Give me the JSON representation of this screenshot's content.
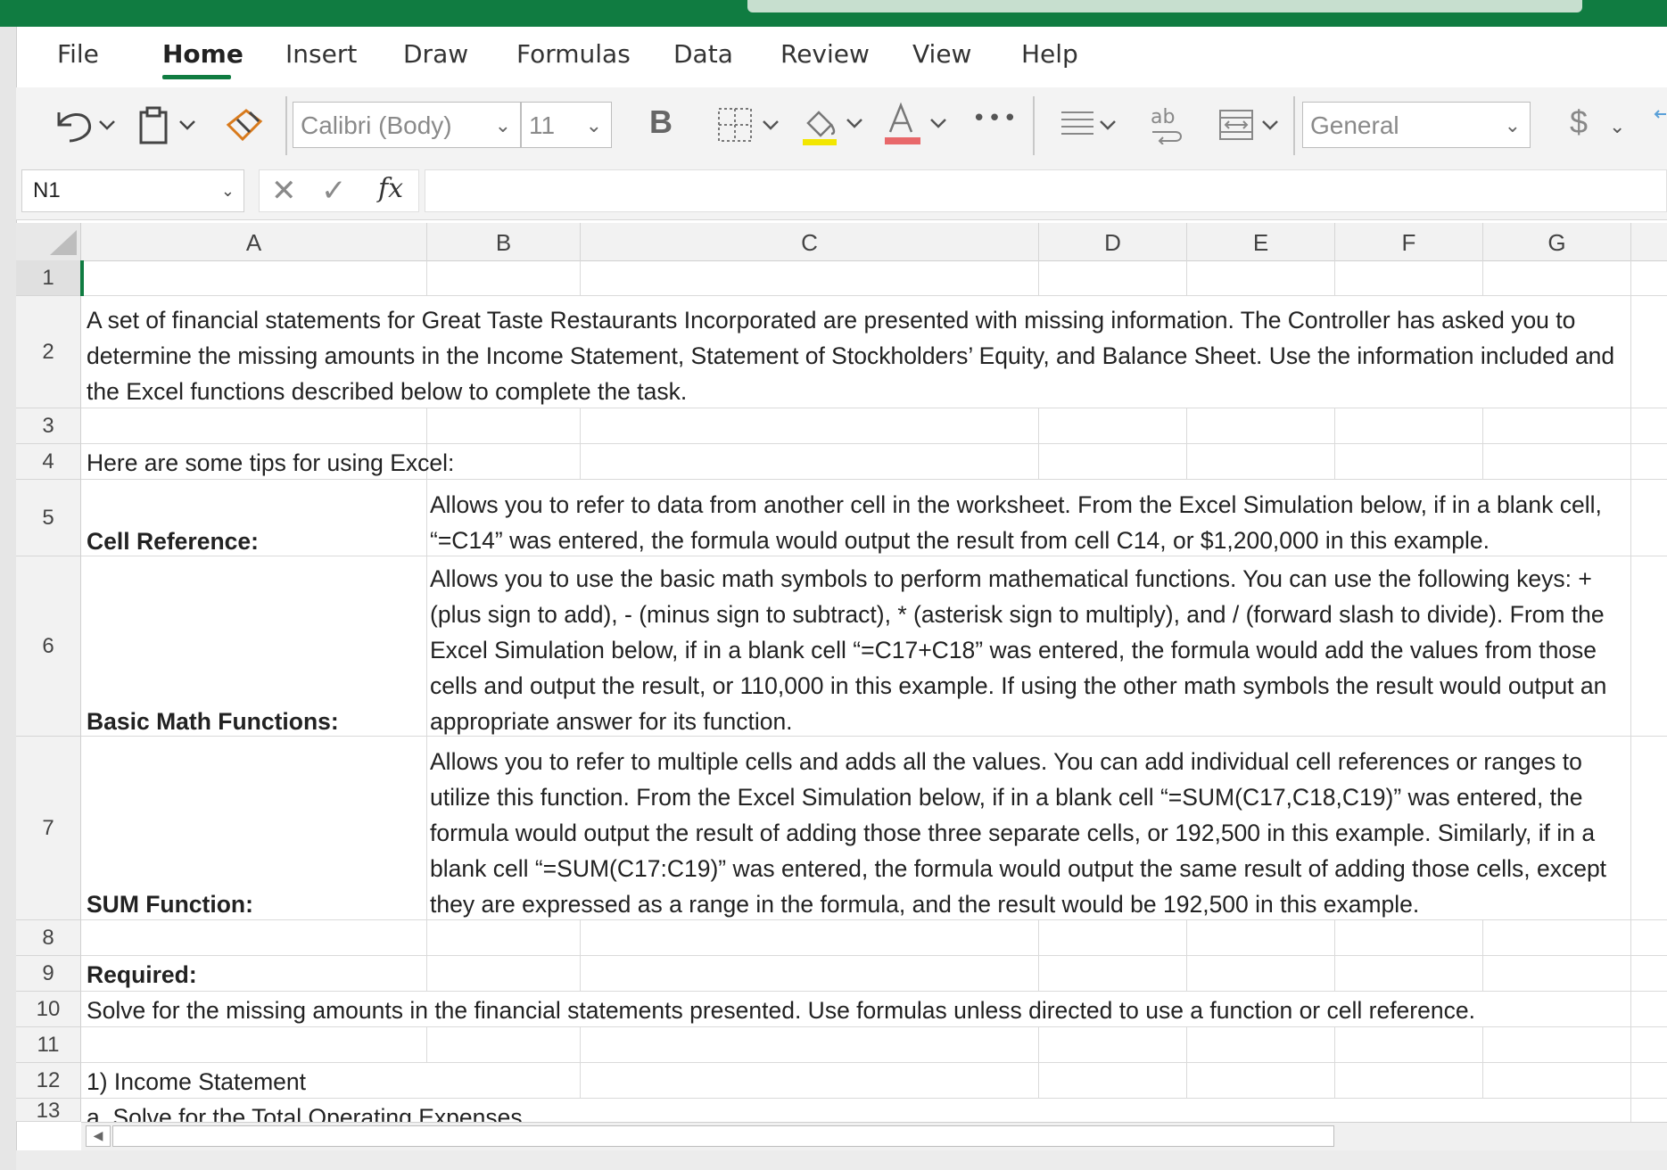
{
  "tabs": [
    {
      "label": "File"
    },
    {
      "label": "Home"
    },
    {
      "label": "Insert"
    },
    {
      "label": "Draw"
    },
    {
      "label": "Formulas"
    },
    {
      "label": "Data"
    },
    {
      "label": "Review"
    },
    {
      "label": "View"
    },
    {
      "label": "Help"
    }
  ],
  "active_tab": "Home",
  "ribbon": {
    "font_name": "Calibri (Body)",
    "font_size": "11",
    "bold_label": "B",
    "number_format": "General",
    "currency_symbol": "$",
    "more_symbol": "•••"
  },
  "formula_bar": {
    "name_box": "N1",
    "fx_label": "fx",
    "formula": ""
  },
  "columns": [
    "A",
    "B",
    "C",
    "D",
    "E",
    "F",
    "G"
  ],
  "rows": [
    {
      "num": "1"
    },
    {
      "num": "2",
      "a": "A set of financial statements for Great Taste Restaurants Incorporated are presented with missing information. The Controller has asked you to determine the missing amounts in the Income Statement, Statement of Stockholders’ Equity, and Balance Sheet. Use the information included and the Excel functions described below to complete the task."
    },
    {
      "num": "3"
    },
    {
      "num": "4",
      "a": "Here are some tips for using Excel:"
    },
    {
      "num": "5",
      "a": "Cell Reference:",
      "b": "Allows you to refer to data from another cell in the worksheet. From the Excel Simulation below, if in a blank cell, “=C14” was entered, the formula would output the result from cell C14, or $1,200,000 in this example."
    },
    {
      "num": "6",
      "a": "Basic Math Functions:",
      "b": "Allows you to use the basic math symbols to perform mathematical functions. You can use the following keys: + (plus sign to add), - (minus sign to subtract), * (asterisk sign to multiply), and / (forward slash to divide). From the Excel Simulation below, if in a blank cell “=C17+C18” was entered, the formula would add the values from those cells and output the result, or 110,000 in this example. If using the other math symbols the result would output an appropriate answer for its function."
    },
    {
      "num": "7",
      "a": "SUM Function:",
      "b": "Allows you to refer to multiple cells and adds all the values. You can add individual cell references or ranges to utilize this function. From the Excel Simulation below, if in a blank cell “=SUM(C17,C18,C19)” was entered, the formula would output the result of adding those three separate cells, or 192,500 in this example. Similarly, if in a blank cell “=SUM(C17:C19)” was entered, the formula would output the same result of adding those cells, except they are expressed as a range in the formula, and the result would be 192,500 in this example."
    },
    {
      "num": "8"
    },
    {
      "num": "9",
      "a": "Required:"
    },
    {
      "num": "10",
      "a": "Solve for the missing amounts in the financial statements presented. Use formulas unless directed to use a function or cell reference."
    },
    {
      "num": "11"
    },
    {
      "num": "12",
      "a": "1) Income Statement"
    },
    {
      "num": "13",
      "a": "a. Solve for the Total Operating Expenses"
    }
  ],
  "colors": {
    "brand_green": "#107c41",
    "fill_yellow": "#f2e600",
    "font_red": "#e8686a"
  }
}
